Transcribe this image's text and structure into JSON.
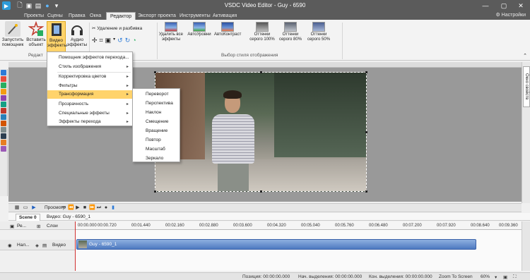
{
  "window": {
    "title": "VSDC Video Editor - Guy - 6590"
  },
  "menu": {
    "tabs": [
      "Проекты",
      "Сцены",
      "Правка",
      "Окна",
      "Редактор",
      "Экспорт проекта",
      "Инструменты",
      "Активация"
    ],
    "active": "Редактор",
    "settings": "Настройки"
  },
  "ribbon": {
    "run_wizard": "Запустить\nпомощник",
    "insert_object": "Вставить\nобъект",
    "video_effects": "Видео\nэффекты",
    "audio_effects": "Аудио\nэффекты",
    "delete_split": "Удаление и разбивка",
    "group_editor": "Редакт",
    "group_style": "Выбор стиля отображения",
    "presets": [
      "Удалить все\nэффекты",
      "АвтоУровни",
      "АвтоКонтраст",
      "Оттенки\nсерого 100%",
      "Оттенки\nсерого 80%",
      "Оттенки\nсерого 50%"
    ],
    "colors": {
      "highlight": "#ffd36b"
    }
  },
  "dropdown": {
    "items": [
      {
        "label": "Помощник эффектов перехода...",
        "arrow": ""
      },
      {
        "label": "Стиль изображения",
        "arrow": "▸"
      },
      {
        "label": "Корректировка цветов",
        "arrow": "▸"
      },
      {
        "label": "Фильтры",
        "arrow": "▸"
      },
      {
        "label": "Трансформация",
        "arrow": "▸"
      },
      {
        "label": "Прозрачность",
        "arrow": "▸"
      },
      {
        "label": "Специальные эффекты",
        "arrow": "▸"
      },
      {
        "label": "Эффекты перехода",
        "arrow": "▸"
      }
    ],
    "active": "Трансформация"
  },
  "submenu": {
    "items": [
      "Переворот",
      "Перспектива",
      "Наклон",
      "Смещение",
      "Вращение",
      "Повтор",
      "Масштаб",
      "Зеркало"
    ]
  },
  "right_panel": {
    "tab": "Окно свойств"
  },
  "playbar": {
    "preview": "Просмотр"
  },
  "scene": {
    "tab": "Scene 0",
    "path": "Видео: Guy - 6590_1"
  },
  "timeline": {
    "header_col1": "Ре...",
    "header_col2": "Слои",
    "ticks": [
      "00:00.000",
      "00:00.720",
      "00:01.440",
      "00:02.160",
      "00:02.880",
      "00:03.600",
      "00:04.320",
      "00:05.040",
      "00:05.760",
      "00:06.480",
      "00:07.200",
      "00:07.920",
      "00:08.640",
      "00:09.360"
    ],
    "row": {
      "name": "Нал...",
      "type": "Видео"
    },
    "clip": "Guy - 6590_1"
  },
  "status": {
    "position": "Позиция:  00:00:00.000",
    "sel_start": "Нач. выделения:  00:00:00.000",
    "sel_end": "Кон. выделения:  00:00:00.000",
    "zoom": "Zoom To Screen",
    "percent": "60%"
  }
}
